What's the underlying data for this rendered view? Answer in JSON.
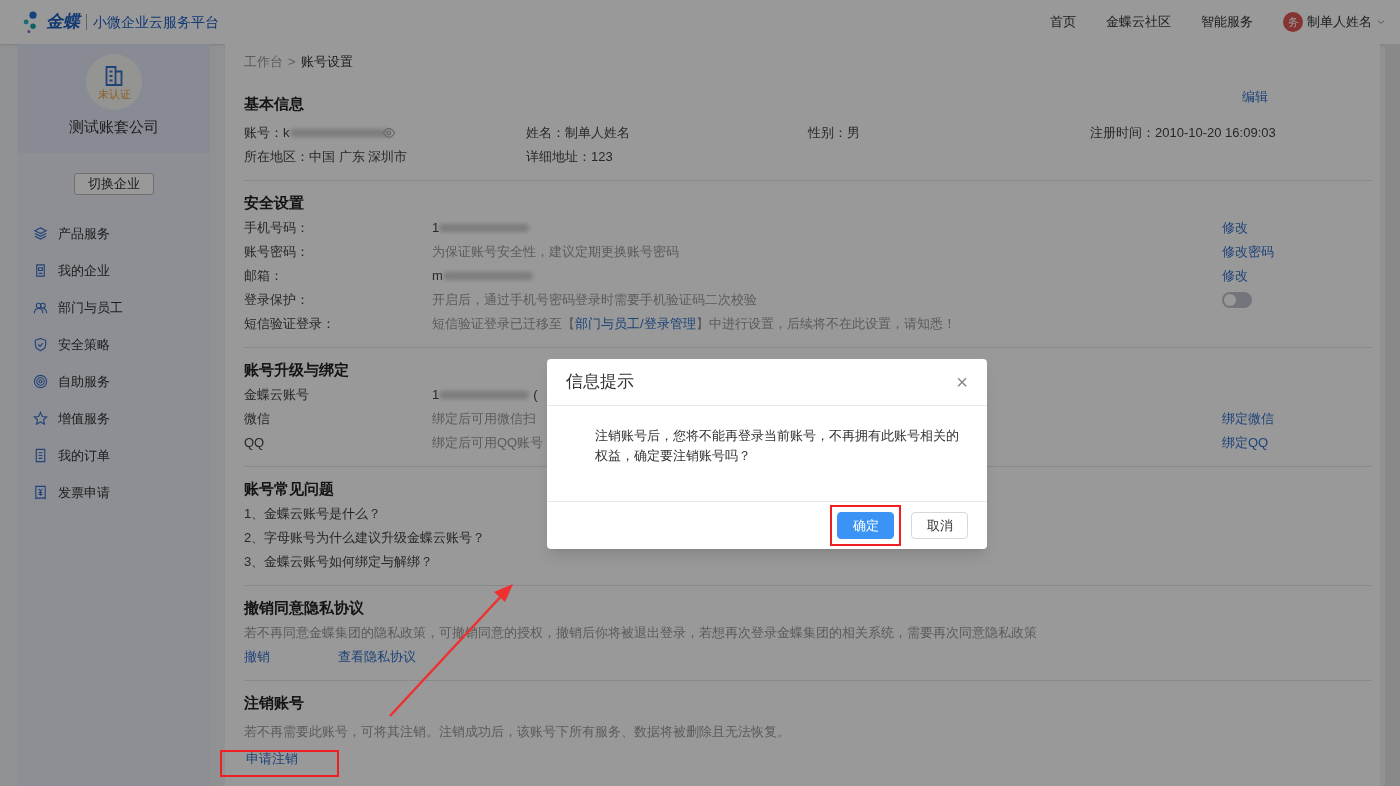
{
  "header": {
    "brand": "金蝶",
    "platform": "小微企业云服务平台",
    "nav": [
      {
        "label": "首页"
      },
      {
        "label": "金蝶云社区"
      },
      {
        "label": "智能服务"
      }
    ],
    "user": {
      "avatar": "务",
      "name": "制单人姓名"
    }
  },
  "sidebar": {
    "company_badge": "未认证",
    "company_name": "测试账套公司",
    "switch_button": "切换企业",
    "items": [
      {
        "label": "产品服务",
        "kind": "layers"
      },
      {
        "label": "我的企业",
        "kind": "building"
      },
      {
        "label": "部门与员工",
        "kind": "users"
      },
      {
        "label": "安全策略",
        "kind": "shield"
      },
      {
        "label": "自助服务",
        "kind": "target"
      },
      {
        "label": "增值服务",
        "kind": "star"
      },
      {
        "label": "我的订单",
        "kind": "list"
      },
      {
        "label": "发票申请",
        "kind": "invoice"
      }
    ]
  },
  "breadcrumb": {
    "items": [
      "工作台",
      "账号设置"
    ],
    "separator": ">"
  },
  "basic_info": {
    "title": "基本信息",
    "edit": "编辑",
    "fields": [
      {
        "label": "账号：",
        "value": "k",
        "masked": true
      },
      {
        "label": "姓名：",
        "value": "制单人姓名",
        "masked": false
      },
      {
        "label": "性别：",
        "value": "男",
        "masked": false
      },
      {
        "label": "注册时间：",
        "value": "2010-10-20 16:09:03",
        "masked": false
      },
      {
        "label": "所在地区：",
        "value": "中国 广东 深圳市",
        "masked": false
      },
      {
        "label": "详细地址：",
        "value": "123",
        "masked": false
      }
    ]
  },
  "security": {
    "title": "安全设置",
    "rows": [
      {
        "kind": "value",
        "label": "手机号码：",
        "value": "1",
        "masked": true,
        "action": "修改"
      },
      {
        "kind": "hint",
        "label": "账号密码：",
        "value": "为保证账号安全性，建议定期更换账号密码",
        "action": "修改密码"
      },
      {
        "kind": "value",
        "label": "邮箱：",
        "value": "m",
        "masked": true,
        "action": "修改"
      },
      {
        "kind": "toggle",
        "label": "登录保护：",
        "value": "开启后，通过手机号密码登录时需要手机验证码二次校验",
        "on": false
      },
      {
        "kind": "link",
        "label": "短信验证登录：",
        "prefix": "短信验证登录已迁移至【",
        "link": "部门与员工/登录管理",
        "suffix": "】中进行设置，后续将不在此设置，请知悉！"
      }
    ]
  },
  "binding": {
    "title": "账号升级与绑定",
    "rows": [
      {
        "kind": "value",
        "label": "金蝶云账号",
        "value": "1",
        "masked": true,
        "suffix": "("
      },
      {
        "kind": "hint",
        "label": "微信",
        "value": "绑定后可用微信扫",
        "action": "绑定微信"
      },
      {
        "kind": "hint",
        "label": "QQ",
        "value": "绑定后可用QQ账号",
        "action": "绑定QQ"
      }
    ]
  },
  "faq": {
    "title": "账号常见问题",
    "items": [
      "1、金蝶云账号是什么？",
      "2、字母账号为什么建议升级金蝶云账号？",
      "3、金蝶云账号如何绑定与解绑？"
    ]
  },
  "privacy": {
    "title": "撤销同意隐私协议",
    "description": "若不再同意金蝶集团的隐私政策，可撤销同意的授权，撤销后你将被退出登录，若想再次登录金蝶集团的相关系统，需要再次同意隐私政策",
    "links": [
      "撤销",
      "查看隐私协议"
    ]
  },
  "cancel_account": {
    "title": "注销账号",
    "description": "若不再需要此账号，可将其注销。注销成功后，该账号下所有服务、数据将被删除且无法恢复。",
    "link": "申请注销"
  },
  "modal": {
    "title": "信息提示",
    "close": "×",
    "message": "注销账号后，您将不能再登录当前账号，不再拥有此账号相关的权益，确定要注销账号吗？",
    "buttons": [
      {
        "label": "确定",
        "kind": "primary"
      },
      {
        "label": "取消",
        "kind": "default"
      }
    ]
  }
}
